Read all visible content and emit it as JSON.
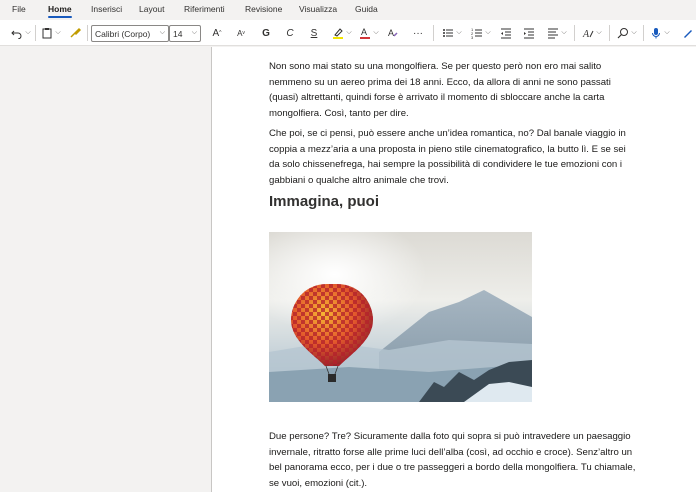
{
  "tabs": [
    "File",
    "Home",
    "Inserisci",
    "Layout",
    "Riferimenti",
    "Revisione",
    "Visualizza",
    "Guida"
  ],
  "active_tab": "Home",
  "toolbar": {
    "font_name": "Calibri (Corpo)",
    "font_size": "14",
    "bold_glyph": "G",
    "italic_glyph": "C",
    "strike_glyph": "S",
    "grow_glyph": "A",
    "shrink_glyph": "A",
    "more_glyph": "···",
    "highlight_color": "#f2e500",
    "font_color": "#d13438"
  },
  "document": {
    "para1": "Non sono mai stato su una mongolfiera. Se per questo però non ero mai salito nemmeno su un aereo prima dei 18 anni. Ecco, da allora di anni ne sono passati (quasi) altrettanti, quindi forse è arrivato il momento di sbloccare anche la carta mongolfiera. Così, tanto per dire.",
    "para2": "Che poi, se ci pensi, può essere anche un’idea romantica, no? Dal banale viaggio in coppia a mezz’aria a una proposta in pieno stile cinematografico, la butto lì. E se sei da solo chissenefrega, hai sempre la possibilità di condividere le tue emozioni con i gabbiani o qualche altro animale che trovi.",
    "heading": "Immagina, puoi",
    "para3": "Due persone? Tre? Sicuramente dalla foto qui sopra si può intravedere un paesaggio invernale, ritratto forse alle prime luci dell’alba (così, ad occhio e croce). Senz’altro un bel panorama ecco, per i due o tre passeggeri a bordo della mongolfiera. Tu chiamale, se vuoi, emozioni (cit.)."
  }
}
